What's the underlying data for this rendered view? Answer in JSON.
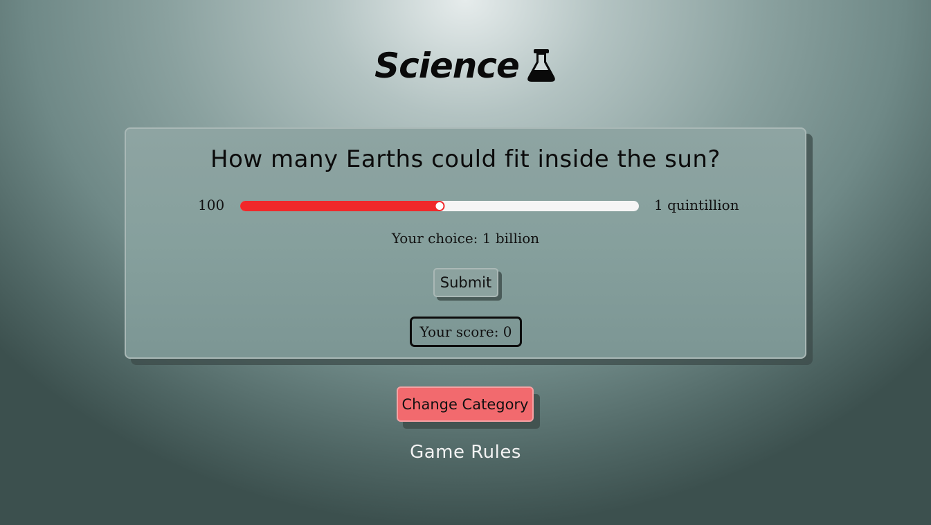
{
  "header": {
    "title": "Science",
    "icon": "flask-icon"
  },
  "question": {
    "text": "How many Earths could fit inside the sun?"
  },
  "slider": {
    "min_label": "100",
    "max_label": "1 quintillion",
    "value_fraction": 0.5,
    "fill_color": "#f0282a",
    "track_color": "#f5f5f5"
  },
  "choice": {
    "label": "Your choice: 1 billion"
  },
  "submit": {
    "label": "Submit"
  },
  "score": {
    "label": "Your score: 0"
  },
  "change_category": {
    "label": "Change Category",
    "color": "#f26a6e"
  },
  "rules": {
    "label": "Game Rules"
  }
}
